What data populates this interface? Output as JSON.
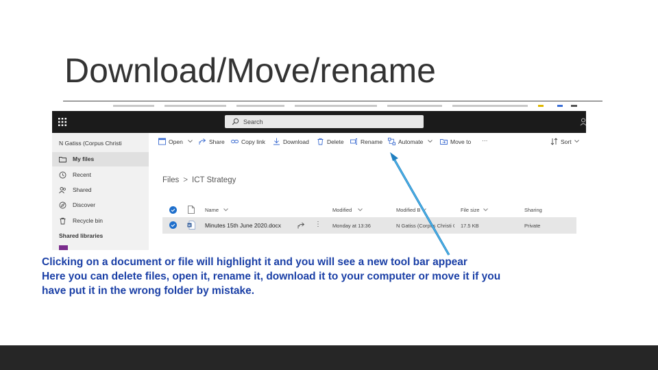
{
  "slide": {
    "title": "Download/Move/rename",
    "caption_lines": [
      "Clicking on a document or file will highlight it and you will see a new tool bar appear",
      "Here you can delete files, open it, rename it, download it to your computer or move it if you",
      "have put it in the wrong folder by mistake."
    ]
  },
  "app": {
    "search_placeholder": "Search",
    "user_name": "N Gatiss (Corpus Christi",
    "sidebar": {
      "items": [
        {
          "label": "My files",
          "icon": "folder-icon"
        },
        {
          "label": "Recent",
          "icon": "clock-icon"
        },
        {
          "label": "Shared",
          "icon": "people-icon"
        },
        {
          "label": "Discover",
          "icon": "compass-icon"
        },
        {
          "label": "Recycle bin",
          "icon": "trash-icon"
        }
      ],
      "section_label": "Shared libraries"
    },
    "toolbar": {
      "open": "Open",
      "share": "Share",
      "copy_link": "Copy link",
      "download": "Download",
      "delete": "Delete",
      "rename": "Rename",
      "automate": "Automate",
      "move_to": "Move to",
      "more": "···",
      "sort": "Sort"
    },
    "breadcrumb": {
      "root": "Files",
      "separator": ">",
      "current": "ICT Strategy"
    },
    "table": {
      "columns": [
        "Name",
        "Modified",
        "Modified By",
        "File size",
        "Sharing"
      ],
      "rows": [
        {
          "name": "Minutes 15th June 2020.docx",
          "modified": "Monday at 13:36",
          "modified_by": "N Gatiss (Corpus Christi C",
          "file_size": "17.5 KB",
          "sharing": "Private"
        }
      ]
    }
  },
  "colors": {
    "accent": "#1e6fcc",
    "caption": "#1a3fa6",
    "arrow": "#2f9fd8",
    "topbar": "#1b1b1b",
    "footer": "#262626"
  }
}
